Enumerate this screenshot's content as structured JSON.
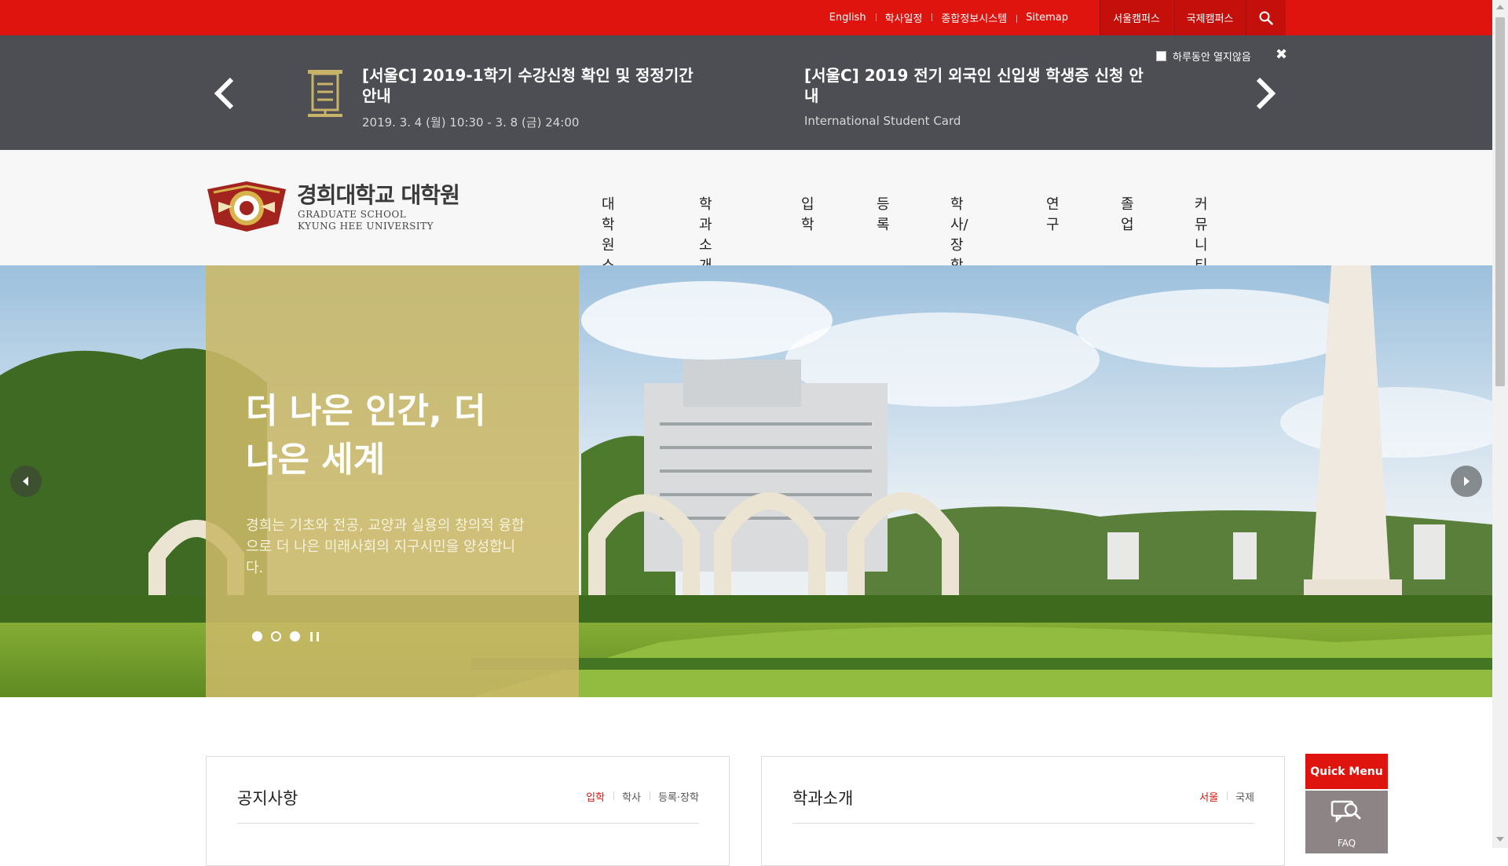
{
  "topbar": {
    "links": [
      "English",
      "학사일정",
      "종합정보시스템",
      "Sitemap"
    ],
    "campus_seoul": "서울캠퍼스",
    "campus_global": "국제캠퍼스",
    "search_icon": "search-icon",
    "color": "#e0140f"
  },
  "notice": {
    "items": [
      {
        "title": "[서울C] 2019-1학기 수강신청 확인 및 정정기간 안내",
        "sub": "2019. 3. 4 (월) 10:30 - 3. 8 (금) 24:00"
      },
      {
        "title": "[서울C] 2019 전기 외국인 신입생 학생증 신청 안내",
        "sub": "International Student Card"
      }
    ],
    "close_label": "하루동안 열지않음",
    "close_icon": "close-icon",
    "background": "#4d4e53"
  },
  "header": {
    "logo_title": "경희대학교 대학원",
    "logo_sub1": "GRADUATE SCHOOL",
    "logo_sub2": "KYUNG HEE UNIVERSITY",
    "nav": [
      "대학원소개",
      "학과소개",
      "입학",
      "등록",
      "학사/장학",
      "연구",
      "졸업",
      "커뮤니티"
    ]
  },
  "hero": {
    "title": "더 나은 인간, 더 나은 세계",
    "desc": "경희는 기초와 전공, 교양과 실용의 창의적 융합으로 더 나은 미래사회의 지구시민을 양성합니다.",
    "panel_color": "#cbb868",
    "active_slide": 1,
    "slide_count": 3
  },
  "cards": [
    {
      "title": "공지사항",
      "tabs": [
        "입학",
        "학사",
        "등록·장학"
      ],
      "active_tab": 0
    },
    {
      "title": "학과소개",
      "tabs": [
        "서울",
        "국제"
      ],
      "active_tab": 0
    }
  ],
  "quick_menu": {
    "label": "Quick Menu",
    "faq_label": "FAQ"
  }
}
